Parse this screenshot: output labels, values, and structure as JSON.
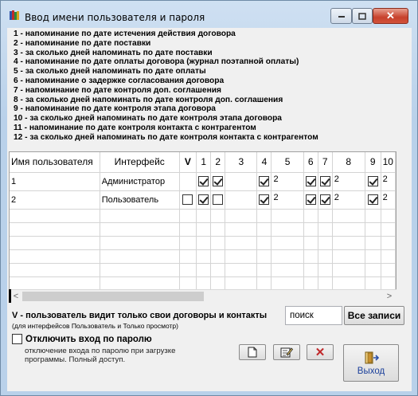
{
  "window": {
    "title": "Ввод имени пользователя и пароля",
    "close_glyph": "✕"
  },
  "legend": [
    "1 - напоминание по дате истечения действия договора",
    "2 - напоминание по дате поставки",
    "3 - за сколько дней напоминать по дате поставки",
    "4 - напоминание по дате оплаты договора (журнал поэтапной оплаты)",
    "5 - за сколько дней напоминать по дате оплаты",
    "6 - напоминание о задержке согласования договора",
    "7 - напоминание по дате контроля доп. соглашения",
    "8 - за сколько дней напоминать по дате контроля доп. соглашения",
    "9 - напоминание по дате контроля этапа договора",
    "10 - за сколько дней напоминать по дате контроля этапа договора",
    "11 - напоминание по дате контроля контакта с контрагентом",
    "12 - за сколько дней напоминать по дате контроля контакта с контрагентом"
  ],
  "grid": {
    "headers": [
      "Имя пользователя",
      "Интерфейс",
      "V",
      "1",
      "2",
      "3",
      "4",
      "5",
      "6",
      "7",
      "8",
      "9",
      "10"
    ],
    "rows": [
      {
        "user": "1",
        "interface": "Администратор",
        "v": null,
        "c1": true,
        "c2": true,
        "c3": null,
        "c4": true,
        "c5": "2",
        "c6": true,
        "c7": true,
        "c8": "2",
        "c9": true,
        "c10": "2"
      },
      {
        "user": "2",
        "interface": "Пользователь",
        "v": false,
        "c1": true,
        "c2": false,
        "c3": null,
        "c4": true,
        "c5": "2",
        "c6": true,
        "c7": true,
        "c8": "2",
        "c9": true,
        "c10": "2"
      }
    ],
    "scroll_left": "<",
    "scroll_right": ">"
  },
  "v_note": "V - пользователь видит только свои договоры и контакты",
  "v_note_sub": "(для интерфейсов Пользователь и Только просмотр)",
  "search": {
    "value": "поиск"
  },
  "all_records_label": "Все записи",
  "disable_login": {
    "label": "Отключить вход по паролю",
    "checked": false,
    "description": "отключение входа по паролю при загрузке программы. Полный доступ."
  },
  "actions": {
    "delete_glyph": "✕",
    "exit_label": "Выход"
  },
  "colors": {
    "delete": "#c0282a",
    "exit_text": "#1a3f9a"
  }
}
